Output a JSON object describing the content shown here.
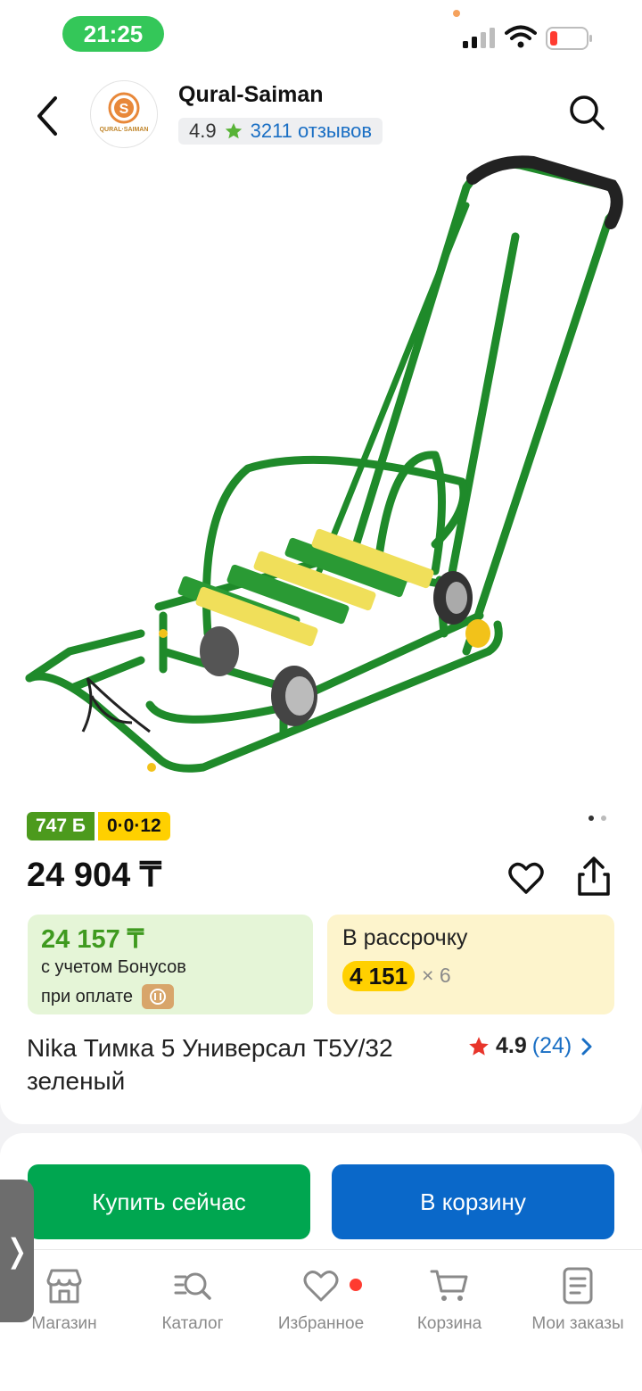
{
  "status_bar": {
    "time": "21:25"
  },
  "header": {
    "shop_name": "Qural-Saiman",
    "logo_text": "QURAL·SAIMAN",
    "shop_rating": "4.9",
    "reviews": "3211 отзывов"
  },
  "product": {
    "badge_bonus": "747 Б",
    "badge_installment": "0·0·12",
    "price": "24 904 ₸",
    "bonus_price": "24 157 ₸",
    "bonus_line1": "с учетом Бонусов",
    "bonus_line2": "при оплате",
    "installment_label": "В рассрочку",
    "installment_amount": "4 151",
    "installment_months": "× 6",
    "title": "Nika Тимка 5 Универсал Т5У/32 зеленый",
    "rating": "4.9",
    "rating_count": "(24)"
  },
  "actions": {
    "buy_now": "Купить сейчас",
    "add_to_cart": "В корзину"
  },
  "tabbar": {
    "items": [
      {
        "label": "Магазин",
        "icon": "store-icon"
      },
      {
        "label": "Каталог",
        "icon": "catalog-search-icon"
      },
      {
        "label": "Избранное",
        "icon": "heart-icon"
      },
      {
        "label": "Корзина",
        "icon": "cart-icon"
      },
      {
        "label": "Мои заказы",
        "icon": "orders-icon"
      }
    ]
  },
  "colors": {
    "green": "#00a650",
    "blue": "#0a68c9",
    "yellow": "#ffd000",
    "status_green": "#34c759"
  },
  "side_handle": {
    "glyph": "❭"
  }
}
